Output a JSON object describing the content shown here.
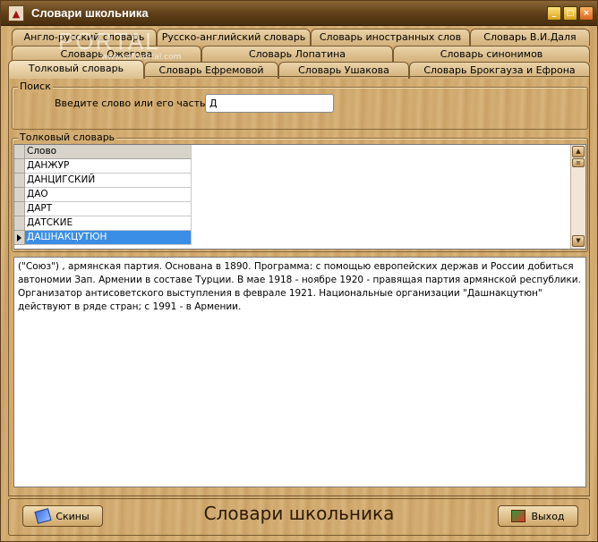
{
  "window": {
    "title": "Словари школьника",
    "icon": "book-app-icon"
  },
  "watermark": {
    "text": "PORTAL",
    "sub": "www.softportal.com"
  },
  "tabs": {
    "row1": [
      {
        "label": "Англо-русский словарь"
      },
      {
        "label": "Русско-английский словарь"
      },
      {
        "label": "Словарь иностранных слов"
      },
      {
        "label": "Словарь В.И.Даля"
      }
    ],
    "row2": [
      {
        "label": "Словарь Ожегова"
      },
      {
        "label": "Словарь Лопатина"
      },
      {
        "label": "Словарь синонимов"
      }
    ],
    "row3": [
      {
        "label": "Толковый словарь"
      },
      {
        "label": "Словарь Ефремовой"
      },
      {
        "label": "Словарь Ушакова"
      },
      {
        "label": "Словарь Брокгауза и Ефрона"
      }
    ],
    "active": "Толковый словарь"
  },
  "search": {
    "group_label": "Поиск",
    "label": "Введите слово или его часть:",
    "value": "Д"
  },
  "wordlist": {
    "group_label": "Толковый словарь",
    "column": "Слово",
    "rows": [
      "ДАНЖУР",
      "ДАНЦИГСКИЙ",
      "ДАО",
      "ДАРТ",
      "ДАТСКИЕ",
      "ДАШНАКЦУТЮН"
    ],
    "selected_index": 5
  },
  "definition": {
    "text": "(\"Союз\") , армянская партия. Основана в 1890. Программа: с помощью европейских держав и России добиться автономии Зап. Армении в составе Турции. В мае 1918 - ноябре 1920 - правящая партия армянской республики. Организатор антисоветского выступления в феврале 1921. Национальные организации \"Дашнакцутюн\" действуют в ряде стран; с 1991 - в Армении."
  },
  "footer": {
    "skins_label": "Скины",
    "title": "Словари школьника",
    "exit_label": "Выход"
  },
  "colors": {
    "titlebar": "#5e3e18",
    "wood": "#d2ac72",
    "selection": "#3a8ee6"
  }
}
